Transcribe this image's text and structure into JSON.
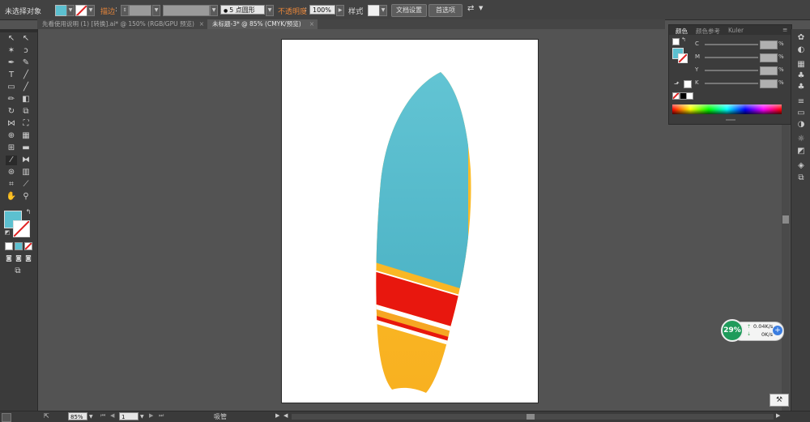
{
  "control_bar": {
    "selection_label": "未选择对象",
    "stroke_label": "描边",
    "brush_value": "5 点圆形",
    "opacity_label": "不透明度",
    "opacity_value": "100%",
    "style_label": "样式",
    "doc_setup_button": "文档设置",
    "preferences_button": "首选项"
  },
  "tabs": [
    {
      "label": "先看使用说明 (1) [转换].ai* @ 150% (RGB/GPU 预览)",
      "active": false
    },
    {
      "label": "未标题-3* @ 85% (CMYK/预览)",
      "active": true
    }
  ],
  "color_panel": {
    "tabs": [
      "颜色",
      "颜色参考",
      "Kuler"
    ],
    "channels": [
      "C",
      "M",
      "Y",
      "K"
    ],
    "percent": "%"
  },
  "status_bar": {
    "zoom_value": "85%",
    "artboard_value": "1",
    "status_label": "吸管"
  },
  "network_widget": {
    "percent": "29%",
    "upload": "0.04K/s",
    "download": "0K/s"
  },
  "colors": {
    "fill": "#5cc0d0",
    "board_blue": "#5ec3d3",
    "board_red": "#e8170e",
    "board_orange": "#f6a623",
    "board_yellow": "#fbbb28",
    "accent_orange": "#e6853a",
    "widget_green": "#1f9b5b"
  }
}
